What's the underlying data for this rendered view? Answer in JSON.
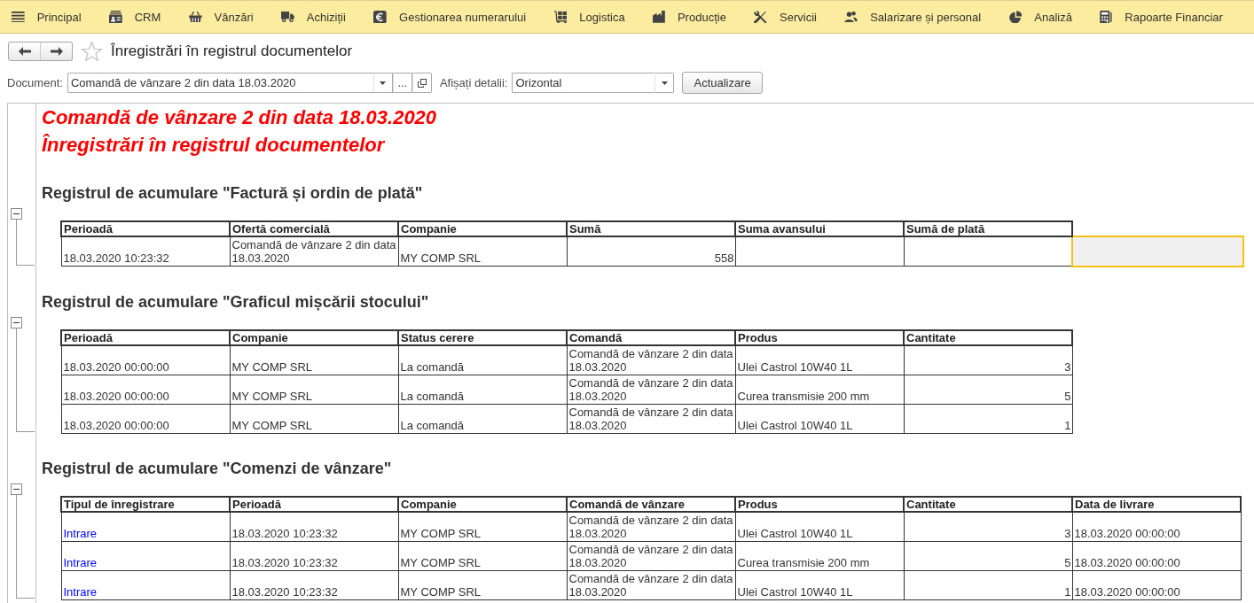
{
  "menu": [
    {
      "label": "Principal"
    },
    {
      "label": "CRM"
    },
    {
      "label": "Vânzări"
    },
    {
      "label": "Achiziții"
    },
    {
      "label": "Gestionarea numerarului"
    },
    {
      "label": "Logistica"
    },
    {
      "label": "Producție"
    },
    {
      "label": "Servicii"
    },
    {
      "label": "Salarizare și personal"
    },
    {
      "label": "Analiză"
    },
    {
      "label": "Rapoarte Financiar"
    }
  ],
  "page": {
    "title": "Înregistrări în registrul documentelor",
    "favorite": false
  },
  "filters": [
    {
      "kind": "reference",
      "label": "Document:",
      "value": "Comandă de vânzare 2 din data 18.03.2020",
      "choose_button": "..."
    },
    {
      "kind": "select",
      "label": "Afișați detalii:",
      "value": "Orizontal"
    }
  ],
  "update_button": "Actualizare",
  "report": {
    "title_lines": [
      "Comandă de vânzare 2 din data 18.03.2020",
      "Înregistrări în registrul documentelor"
    ],
    "sections": [
      {
        "heading": "Registrul de acumulare \"Factură și ordin de plată\"",
        "expanded": true,
        "columns": [
          {
            "title": "Perioadă",
            "kind": "text"
          },
          {
            "title": "Ofertă comercială",
            "kind": "text"
          },
          {
            "title": "Companie",
            "kind": "text"
          },
          {
            "title": "Sumă",
            "kind": "number"
          },
          {
            "title": "Suma avansului",
            "kind": "number"
          },
          {
            "title": "Sumă de plată",
            "kind": "number"
          }
        ],
        "rows": [
          {
            "selected": true,
            "cells": [
              "18.03.2020 10:23:32",
              "Comandă de vânzare 2 din data 18.03.2020",
              "MY COMP SRL",
              "558",
              null,
              null
            ]
          }
        ]
      },
      {
        "heading": "Registrul de acumulare \"Graficul mișcării stocului\"",
        "expanded": true,
        "columns": [
          {
            "title": "Perioadă",
            "kind": "text"
          },
          {
            "title": "Companie",
            "kind": "text"
          },
          {
            "title": "Status cerere",
            "kind": "text"
          },
          {
            "title": "Comandă",
            "kind": "text"
          },
          {
            "title": "Produs",
            "kind": "text"
          },
          {
            "title": "Cantitate",
            "kind": "number"
          }
        ],
        "rows": [
          {
            "selected": false,
            "cells": [
              "18.03.2020 00:00:00",
              "MY COMP SRL",
              "La comandă",
              "Comandă de vânzare 2 din data 18.03.2020",
              "Ulei Castrol 10W40 1L",
              "3"
            ]
          },
          {
            "selected": false,
            "cells": [
              "18.03.2020 00:00:00",
              "MY COMP SRL",
              "La comandă",
              "Comandă de vânzare 2 din data 18.03.2020",
              "Curea transmisie 200 mm",
              "5"
            ]
          },
          {
            "selected": false,
            "cells": [
              "18.03.2020 00:00:00",
              "MY COMP SRL",
              "La comandă",
              "Comandă de vânzare 2 din data 18.03.2020",
              "Ulei Castrol 10W40 1L",
              "1"
            ]
          }
        ]
      },
      {
        "heading": "Registrul de acumulare \"Comenzi de vânzare\"",
        "expanded": true,
        "columns": [
          {
            "title": "Tipul de înregistrare",
            "kind": "link"
          },
          {
            "title": "Perioadă",
            "kind": "text"
          },
          {
            "title": "Companie",
            "kind": "text"
          },
          {
            "title": "Comandă de vânzare",
            "kind": "text"
          },
          {
            "title": "Produs",
            "kind": "text"
          },
          {
            "title": "Cantitate",
            "kind": "number"
          },
          {
            "title": "Data de livrare",
            "kind": "text"
          }
        ],
        "rows": [
          {
            "selected": false,
            "cells": [
              "Intrare",
              "18.03.2020 10:23:32",
              "MY COMP SRL",
              "Comandă de vânzare 2 din data 18.03.2020",
              "Ulei Castrol 10W40 1L",
              "3",
              "18.03.2020 00:00:00"
            ]
          },
          {
            "selected": false,
            "cells": [
              "Intrare",
              "18.03.2020 10:23:32",
              "MY COMP SRL",
              "Comandă de vânzare 2 din data 18.03.2020",
              "Curea transmisie 200 mm",
              "5",
              "18.03.2020 00:00:00"
            ]
          },
          {
            "selected": false,
            "cells": [
              "Intrare",
              "18.03.2020 10:23:32",
              "MY COMP SRL",
              "Comandă de vânzare 2 din data 18.03.2020",
              "Ulei Castrol 10W40 1L",
              "1",
              "18.03.2020 00:00:00"
            ]
          }
        ]
      }
    ]
  }
}
